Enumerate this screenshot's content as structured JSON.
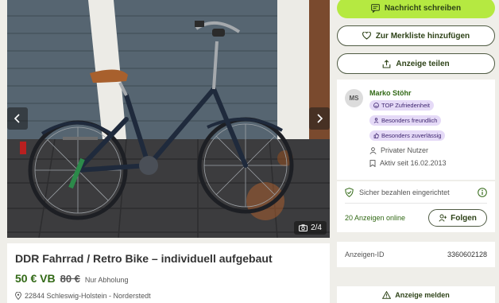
{
  "gallery": {
    "counter": "2/4",
    "prev_icon": "chevron-left-icon",
    "next_icon": "chevron-right-icon",
    "camera_icon": "camera-icon"
  },
  "listing": {
    "title": "DDR Fahrrad / Retro Bike – individuell aufgebaut",
    "price": "50 € VB",
    "old_price": "80 €",
    "shipping": "Nur Abholung",
    "location": "22844 Schleswig-Holstein - Norderstedt"
  },
  "actions": {
    "message_label": "Nachricht schreiben",
    "watchlist_label": "Zur Merkliste hinzufügen",
    "share_label": "Anzeige teilen"
  },
  "seller": {
    "initials": "MS",
    "name": "Marko Stöhr",
    "badges": [
      "TOP Zufriedenheit",
      "Besonders freundlich",
      "Besonders zuverlässig"
    ],
    "type": "Privater Nutzer",
    "active_since": "Aktiv seit 16.02.2013"
  },
  "trust": {
    "secure_payment": "Sicher bezahlen eingerichtet",
    "online_ads": "20 Anzeigen online",
    "follow_label": "Folgen"
  },
  "ad": {
    "id_label": "Anzeigen-ID",
    "id_value": "3360602128",
    "report_label": "Anzeige melden"
  },
  "colors": {
    "primary": "#b5e941",
    "text_green": "#326916",
    "badge_bg": "#e5daf7"
  }
}
